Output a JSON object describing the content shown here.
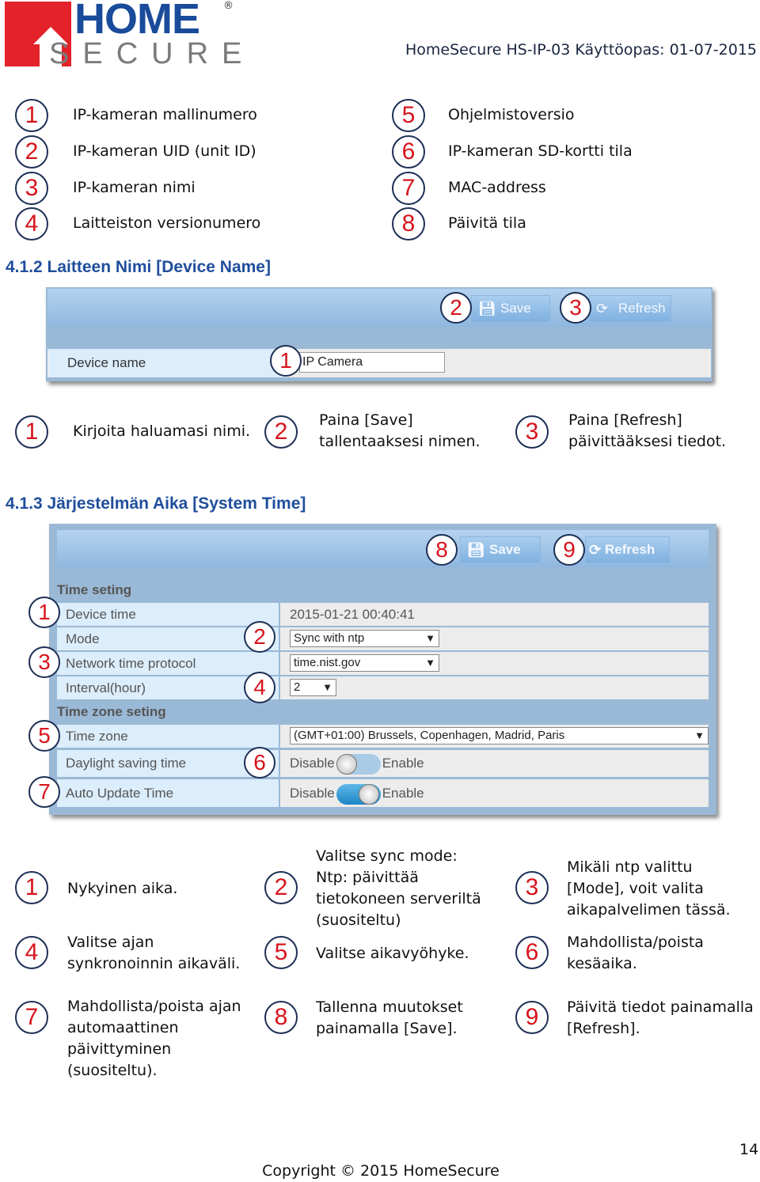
{
  "header": {
    "logo_home": "HOME",
    "logo_secure": "SECURE",
    "logo_reg": "®",
    "title": "HomeSecure HS-IP-03 Käyttöopas: 01-07-2015"
  },
  "legend": [
    {
      "n": "1",
      "text": "IP-kameran mallinumero"
    },
    {
      "n": "2",
      "text": "IP-kameran UID (unit ID)"
    },
    {
      "n": "3",
      "text": "IP-kameran nimi"
    },
    {
      "n": "4",
      "text": "Laitteiston versionumero"
    },
    {
      "n": "5",
      "text": "Ohjelmistoversio"
    },
    {
      "n": "6",
      "text": "IP-kameran SD-kortti tila"
    },
    {
      "n": "7",
      "text": "MAC-address"
    },
    {
      "n": "8",
      "text": "Päivitä tila"
    }
  ],
  "section1": {
    "heading": "4.1.2 Laitteen Nimi [Device Name]",
    "screenshot": {
      "save": "Save",
      "refresh": "Refresh",
      "device_name_label": "Device name",
      "device_name_value": "IP Camera",
      "badges": [
        "1",
        "2",
        "3"
      ]
    },
    "notes": [
      {
        "n": "1",
        "text": "Kirjoita haluamasi nimi."
      },
      {
        "n": "2",
        "text": "Paina [Save]\ntallentaaksesi nimen."
      },
      {
        "n": "3",
        "text": "Paina [Refresh]\npäivittääksesi tiedot."
      }
    ]
  },
  "section2": {
    "heading": "4.1.3 Järjestelmän Aika [System Time]",
    "screenshot": {
      "save": "Save",
      "refresh": "Refresh",
      "time_section": "Time seting",
      "tz_section": "Time zone seting",
      "device_time_label": "Device time",
      "device_time_value": "2015-01-21 00:40:41",
      "mode_label": "Mode",
      "mode_value": "Sync with ntp",
      "ntp_label": "Network time protocol",
      "ntp_value": "time.nist.gov",
      "interval_label": "Interval(hour)",
      "interval_value": "2",
      "tz_label": "Time zone",
      "tz_value": "(GMT+01:00) Brussels, Copenhagen, Madrid, Paris",
      "dst_label": "Daylight saving time",
      "dst_enabled": false,
      "auto_label": "Auto Update Time",
      "auto_enabled": true,
      "disable": "Disable",
      "enable": "Enable",
      "badges": [
        "1",
        "2",
        "3",
        "4",
        "5",
        "6",
        "7",
        "8",
        "9"
      ]
    },
    "notes": [
      {
        "n": "1",
        "text": "Nykyinen aika."
      },
      {
        "n": "2",
        "text": "Valitse sync mode:\nNtp: päivittää\ntietokoneen serveriltä\n(suositeltu)"
      },
      {
        "n": "3",
        "text": "Mikäli ntp valittu\n[Mode], voit valita\naikapalvelimen tässä."
      },
      {
        "n": "4",
        "text": "Valitse ajan\nsynkronoinnin aikaväli."
      },
      {
        "n": "5",
        "text": "Valitse aikavyöhyke."
      },
      {
        "n": "6",
        "text": "Mahdollista/poista\nkesäaika."
      },
      {
        "n": "7",
        "text": "Mahdollista/poista ajan\nautomaattinen\npäivittyminen\n(suositeltu)."
      },
      {
        "n": "8",
        "text": "Tallenna muutokset\npainamalla [Save]."
      },
      {
        "n": "9",
        "text": "Päivitä tiedot painamalla\n[Refresh]."
      }
    ]
  },
  "footer": {
    "page": "14",
    "copyright": "Copyright © 2015 HomeSecure"
  },
  "colors": {
    "badge_number": "#d7141c",
    "heading": "#1f4e9c",
    "logo_red": "#e3222a",
    "logo_blue": "#1a4b9b"
  }
}
